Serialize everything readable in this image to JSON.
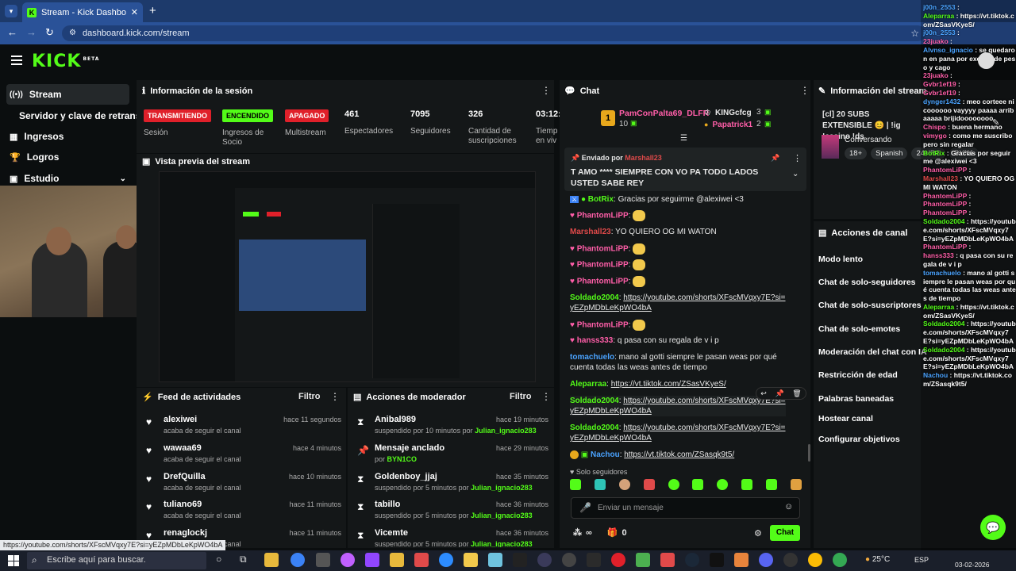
{
  "browser": {
    "tab_title": "Stream - Kick Dashboard",
    "url": "dashboard.kick.com/stream",
    "status_url": "https://youtube.com/shorts/XFscMVqxy7E?si=yEZpMDbLeKpWO4bA"
  },
  "kick": {
    "logo": "KICK",
    "beta": "BETA"
  },
  "sidebar": {
    "items": [
      {
        "label": "Stream"
      },
      {
        "label": "Servidor y clave de retransm"
      },
      {
        "label": "Ingresos"
      },
      {
        "label": "Logros"
      },
      {
        "label": "Estudio"
      }
    ]
  },
  "session": {
    "title": "Información de la sesión",
    "badges": [
      {
        "label": "TRANSMITIENDO",
        "caption": "Sesión",
        "color": "#e0202a"
      },
      {
        "label": "ENCENDIDO",
        "caption": "Ingresos de Socio",
        "color": "#53fc18"
      },
      {
        "label": "APAGADO",
        "caption": "Multistream",
        "color": "#e0202a"
      }
    ],
    "stats": [
      {
        "value": "461",
        "label": "Espectadores"
      },
      {
        "value": "7095",
        "label": "Seguidores"
      },
      {
        "value": "326",
        "label": "Cantidad de suscripciones"
      },
      {
        "value": "03:12:",
        "label": "Tiemp en viv"
      }
    ]
  },
  "preview": {
    "title": "Vista previa del stream"
  },
  "feed": {
    "title": "Feed de actividades",
    "filter": "Filtro",
    "items": [
      {
        "name": "alexiwei",
        "sub": "acaba de seguir el canal",
        "time": "hace 11 segundos"
      },
      {
        "name": "wawaa69",
        "sub": "acaba de seguir el canal",
        "time": "hace 4 minutos"
      },
      {
        "name": "DrefQuilla",
        "sub": "acaba de seguir el canal",
        "time": "hace 10 minutos"
      },
      {
        "name": "tuliano69",
        "sub": "acaba de seguir el canal",
        "time": "hace 11 minutos"
      },
      {
        "name": "renaglockj",
        "sub": "acaba de seguir el canal",
        "time": "hace 11 minutos"
      }
    ]
  },
  "mod": {
    "title": "Acciones de moderador",
    "filter": "Filtro",
    "items": [
      {
        "name": "Anibal989",
        "sub": "suspendido por 10 minutos por",
        "by": "Julian_ignacio283",
        "time": "hace 19 minutos",
        "icon": "hourglass"
      },
      {
        "name": "Mensaje anclado",
        "sub": "por",
        "by": "BYN1CO",
        "time": "hace 29 minutos",
        "icon": "pin"
      },
      {
        "name": "Goldenboy_jjaj",
        "sub": "suspendido por 5 minutos por",
        "by": "Julian_ignacio283",
        "time": "hace 35 minutos",
        "icon": "hourglass"
      },
      {
        "name": "tabillo",
        "sub": "suspendido por 5 minutos por",
        "by": "Julian_ignacio283",
        "time": "hace 36 minutos",
        "icon": "hourglass"
      },
      {
        "name": "Vicemte",
        "sub": "suspendido por 5 minutos por",
        "by": "Julian_ignacio283",
        "time": "hace 36 minutos",
        "icon": "hourglass"
      }
    ]
  },
  "chat": {
    "title": "Chat",
    "top_gifter": {
      "rank": "1",
      "name": "PamConPalta69_DLFR",
      "count": "10"
    },
    "gifters": [
      {
        "name": "KINGcfcg",
        "count": "3"
      },
      {
        "name": "Papatrick1",
        "count": "2"
      }
    ],
    "pinned": {
      "by_label": "Enviado por",
      "by": "Marshall23",
      "text": "T AMO **** SIEMPRE CON VO PA TODO LADOS USTED SABE REY"
    },
    "messages": [
      {
        "user": "BotRix",
        "text": ": Gracias por seguirme @alexiwei <3",
        "color": "#53fc18"
      },
      {
        "user": "PhantomLiPP",
        "text": ":",
        "color": "#ff5ea8"
      },
      {
        "user": "Marshall23",
        "text": ": YO QUIERO OG MI WATON",
        "color": "#e04a4a"
      },
      {
        "user": "PhantomLiPP",
        "text": ":",
        "color": "#ff5ea8"
      },
      {
        "user": "PhantomLiPP",
        "text": ":",
        "color": "#ff5ea8"
      },
      {
        "user": "PhantomLiPP",
        "text": ":",
        "color": "#ff5ea8"
      },
      {
        "user": "Soldado2004",
        "text": ": ",
        "link": "https://youtube.com/shorts/XFscMVqxy7E?si=yEZpMDbLeKpWO4bA",
        "color": "#53fc18"
      },
      {
        "user": "PhantomLiPP",
        "text": ":",
        "color": "#ff5ea8"
      },
      {
        "user": "hanss333",
        "text": ": q pasa con su regala de v i p",
        "color": "#ff5ea8"
      },
      {
        "user": "tomachuelo",
        "text": ": mano al gotti siempre le pasan weas por qué cuenta todas las weas antes de tiempo",
        "color": "#4aa3ff"
      },
      {
        "user": "Aleparraa",
        "text": ": ",
        "link": "https://vt.tiktok.com/ZSasVKyeS/",
        "color": "#53fc18"
      },
      {
        "user": "Soldado2004",
        "text": ": ",
        "link": "https://youtube.com/shorts/XFscMVqxy7E?si=yEZpMDbLeKpWO4bA",
        "color": "#53fc18"
      },
      {
        "user": "Soldado2004",
        "text": ": ",
        "link": "https://youtube.com/shorts/XFscMVqxy7E?si=yEZpMDbLeKpWO4bA",
        "color": "#53fc18"
      },
      {
        "user": "Nachou",
        "text": ": ",
        "link": "https://vt.tiktok.com/ZSasqk9t5/",
        "color": "#4aa3ff"
      }
    ],
    "followers_only": "Solo seguidores",
    "input_placeholder": "Enviar un mensaje",
    "infinity": "∞",
    "gift_count": "0",
    "send_label": "Chat"
  },
  "stream_info": {
    "title": "Información del stream",
    "stream_title": "[cl] 20 SUBS EXTENSIBLE 😊 | !ig !casino !ds",
    "category": "Conversando",
    "tags": [
      "18+",
      "Spanish",
      "24HRS",
      "BYN1"
    ]
  },
  "channel_actions": {
    "title": "Acciones de canal",
    "items": [
      "Modo lento",
      "Chat de solo-seguidores",
      "Chat de solo-suscriptores",
      "Chat de solo-emotes",
      "Moderación del chat con IA",
      "Restricción de edad",
      "Palabras baneadas",
      "Hostear canal",
      "Configurar objetivos"
    ]
  },
  "overlay": {
    "lines": [
      {
        "user": "j00n_2553",
        "text": ":"
      },
      {
        "user": "Aleparraa",
        "text": ": https://vt.tiktok.com/ZSasVKyeS/"
      },
      {
        "user": "j00n_2553",
        "text": ":"
      },
      {
        "user": "23juako",
        "text": ":"
      },
      {
        "user": "Alvnso_ignacio",
        "text": ": se quedaron en pana por exceso de peso y cago"
      },
      {
        "user": "23juako",
        "text": ":"
      },
      {
        "user": "Gvbr1ef19",
        "text": ":"
      },
      {
        "user": "Gvbr1ef19",
        "text": ":"
      },
      {
        "user": "dynger1432",
        "text": ": meo corteee nicoooooo vayyyy paaaa arribaaaaa brijidoooooooo"
      },
      {
        "user": "Chispo",
        "text": ": buena hermano"
      },
      {
        "user": "vimygo",
        "text": ": como me suscribo pero sin regalar"
      },
      {
        "user": "BotRix",
        "text": ": Gracias por seguirme @alexiwei <3"
      },
      {
        "user": "PhantomLiPP",
        "text": ":"
      },
      {
        "user": "Marshall23",
        "text": ": YO QUIERO OG MI WATON"
      },
      {
        "user": "PhantomLiPP",
        "text": ":"
      },
      {
        "user": "PhantomLiPP",
        "text": ":"
      },
      {
        "user": "PhantomLiPP",
        "text": ":"
      },
      {
        "user": "Soldado2004",
        "text": ": https://youtube.com/shorts/XFscMVqxy7E?si=yEZpMDbLeKpWO4bA"
      },
      {
        "user": "PhantomLiPP",
        "text": ":"
      },
      {
        "user": "hanss333",
        "text": ": q pasa con su regala de v i p"
      },
      {
        "user": "tomachuelo",
        "text": ": mano al gotti siempre le pasan weas por qué cuenta todas las weas antes de tiempo"
      },
      {
        "user": "Aleparraa",
        "text": ": https://vt.tiktok.com/ZSasVKyeS/"
      },
      {
        "user": "Soldado2004",
        "text": ": https://youtube.com/shorts/XFscMVqxy7E?si=yEZpMDbLeKpWO4bA"
      },
      {
        "user": "Soldado2004",
        "text": ": https://youtube.com/shorts/XFscMVqxy7E?si=yEZpMDbLeKpWO4bA"
      },
      {
        "user": "Nachou",
        "text": ": https://vt.tiktok.com/ZSasqk9t5/"
      }
    ]
  },
  "taskbar": {
    "search_placeholder": "Escribe aquí para buscar.",
    "temp": "25°C",
    "lang": "ESP",
    "date": "03-02-2026"
  }
}
